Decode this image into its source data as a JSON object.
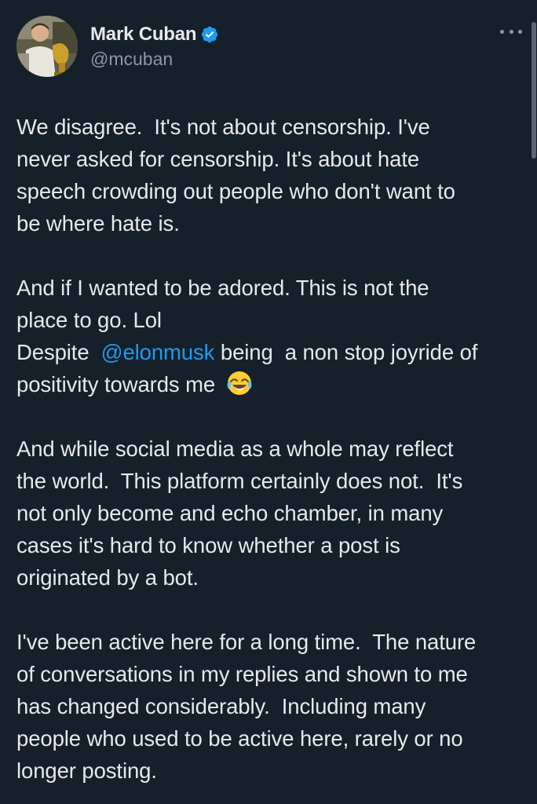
{
  "author": {
    "display_name": "Mark Cuban",
    "handle": "@mcuban",
    "verified": true,
    "verified_badge_color": "#1d9bf0"
  },
  "more_button_icon": "more-horizontal-icon",
  "tweet": {
    "paragraphs": [
      {
        "lines": [
          "We disagree.  It's not about censorship. I've",
          "never asked for censorship. It's about hate",
          "speech crowding out people who don't want to",
          "be where hate is."
        ]
      },
      {
        "lines": [
          "And if I wanted to be adored. This is not the",
          "place to go. Lol"
        ],
        "mention_line": {
          "before": "Despite  ",
          "mention": "@elonmusk",
          "after": " being  a non stop joyride of"
        },
        "last_line": "positivity towards me",
        "emoji": "face-with-tears-of-joy-emoji"
      },
      {
        "lines": [
          "And while social media as a whole may reflect",
          "the world.  This platform certainly does not.  It's",
          "not only become and echo chamber, in many",
          "cases it's hard to know whether a post is",
          "originated by a bot."
        ]
      },
      {
        "lines": [
          "I've been active here for a long time.  The nature",
          "of conversations in my replies and shown to me",
          "has changed considerably.  Including many",
          "people who used to be active here, rarely or no",
          "longer posting."
        ]
      }
    ]
  },
  "colors": {
    "background": "#15202b",
    "text": "#e7e9ea",
    "secondary_text": "#8b98a5",
    "link": "#1d9bf0"
  }
}
